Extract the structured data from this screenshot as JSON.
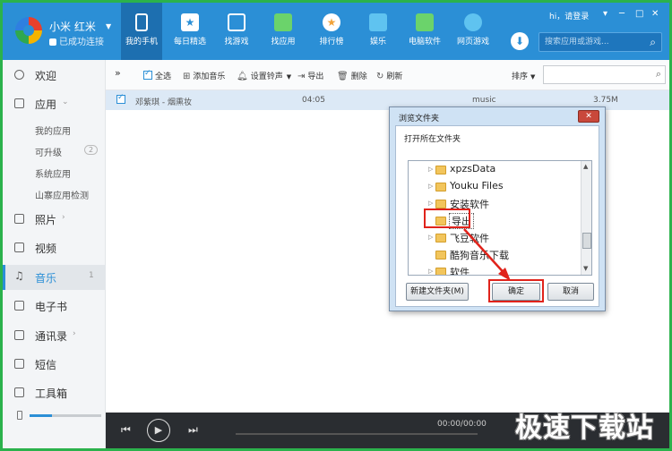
{
  "device": {
    "name": "小米 红米",
    "status": "已成功连接"
  },
  "nav_tabs": [
    {
      "label": "我的手机",
      "icon": "phone-icon",
      "color": "#ffffff"
    },
    {
      "label": "每日精选",
      "icon": "calendar-star-icon",
      "color": "#ffffff"
    },
    {
      "label": "找游戏",
      "icon": "gamepad-icon",
      "color": "#ffffff"
    },
    {
      "label": "找应用",
      "icon": "bag-icon",
      "color": "#6bd36b"
    },
    {
      "label": "排行榜",
      "icon": "medal-icon",
      "color": "#f1a33b"
    },
    {
      "label": "娱乐",
      "icon": "house-icon",
      "color": "#5fc3f0"
    },
    {
      "label": "电脑软件",
      "icon": "monitor-icon",
      "color": "#6bd36b"
    },
    {
      "label": "网页游戏",
      "icon": "globe-game-icon",
      "color": "#5fc3f0"
    }
  ],
  "header": {
    "login": "hi，请登录",
    "search_placeholder": "搜索应用或游戏..."
  },
  "sidebar": {
    "items": [
      {
        "label": "欢迎"
      },
      {
        "label": "应用"
      },
      {
        "label": "照片"
      },
      {
        "label": "视频"
      },
      {
        "label": "音乐",
        "count": "1"
      },
      {
        "label": "电子书"
      },
      {
        "label": "通讯录"
      },
      {
        "label": "短信"
      },
      {
        "label": "工具箱"
      }
    ],
    "app_sub": [
      "我的应用",
      "可升级",
      "系统应用",
      "山寨应用检测"
    ],
    "upgrade_count": "2"
  },
  "toolbar": {
    "expand": "»",
    "select_all": "全选",
    "add_music": "添加音乐",
    "set_ringtone": "设置铃声",
    "export": "导出",
    "delete": "删除",
    "refresh": "刷新",
    "sort": "排序"
  },
  "track": {
    "title": "邓紫琪 - 烟熏妆",
    "duration": "04:05",
    "type": "music",
    "size": "3.75M"
  },
  "dialog": {
    "title": "浏览文件夹",
    "close": "✕",
    "message": "打开所在文件夹",
    "folders": [
      "xpzsData",
      "Youku Files",
      "安装软件",
      "导出",
      "飞豆软件",
      "酷狗音乐下载",
      "软件"
    ],
    "selected_index": 3,
    "new_folder": "新建文件夹(M)",
    "ok": "确定",
    "cancel": "取消"
  },
  "player": {
    "time": "00:00/00:00"
  },
  "watermark": "极速下载站",
  "colors": {
    "accent": "#2b8fd6",
    "highlight": "#e0231b",
    "frame": "#2bb24c"
  }
}
